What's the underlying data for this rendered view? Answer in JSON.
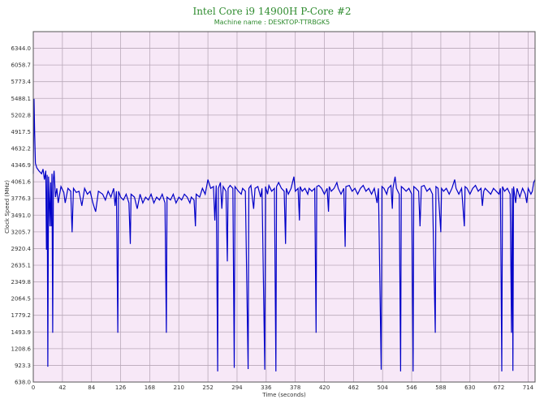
{
  "chart_data": {
    "type": "line",
    "title": "Intel Core i9 14900H P-Core #2",
    "subtitle": "Machine name : DESKTOP-TTRBGK5",
    "xlabel": "Time (seconds)",
    "ylabel": "Clock Speed (MHz)",
    "xlim": [
      0,
      724
    ],
    "ylim": [
      638.0,
      6629.0
    ],
    "x_ticks": [
      0,
      42,
      84,
      126,
      168,
      210,
      252,
      294,
      336,
      378,
      420,
      462,
      504,
      546,
      588,
      630,
      672,
      714
    ],
    "y_ticks": [
      638.0,
      923.3,
      1208.6,
      1493.9,
      1779.2,
      2064.5,
      2349.8,
      2635.1,
      2920.4,
      3205.7,
      3491.0,
      3776.3,
      4061.6,
      4346.9,
      4632.2,
      4917.5,
      5202.8,
      5488.1,
      5773.4,
      6058.7,
      6344.0
    ],
    "grid": true,
    "colors": {
      "line": "#0000c8",
      "plot_bg": "#f7e8f7",
      "grid": "#b9a9b9",
      "title": "#2e8b2e"
    },
    "series": [
      {
        "points": [
          [
            0,
            4200
          ],
          [
            1,
            5480
          ],
          [
            2,
            4900
          ],
          [
            3,
            4380
          ],
          [
            5,
            4300
          ],
          [
            8,
            4250
          ],
          [
            12,
            4200
          ],
          [
            14,
            4280
          ],
          [
            16,
            4100
          ],
          [
            18,
            4250
          ],
          [
            19,
            2900
          ],
          [
            20,
            4180
          ],
          [
            21,
            900
          ],
          [
            22,
            4150
          ],
          [
            24,
            3300
          ],
          [
            25,
            4050
          ],
          [
            26,
            3300
          ],
          [
            27,
            4200
          ],
          [
            28,
            1480
          ],
          [
            29,
            4120
          ],
          [
            30,
            4250
          ],
          [
            32,
            3800
          ],
          [
            34,
            3950
          ],
          [
            36,
            3700
          ],
          [
            40,
            3980
          ],
          [
            44,
            3880
          ],
          [
            46,
            3700
          ],
          [
            50,
            3950
          ],
          [
            54,
            3900
          ],
          [
            56,
            3200
          ],
          [
            58,
            3950
          ],
          [
            62,
            3880
          ],
          [
            66,
            3900
          ],
          [
            70,
            3650
          ],
          [
            74,
            3950
          ],
          [
            78,
            3850
          ],
          [
            82,
            3900
          ],
          [
            86,
            3700
          ],
          [
            90,
            3550
          ],
          [
            94,
            3900
          ],
          [
            100,
            3850
          ],
          [
            104,
            3750
          ],
          [
            108,
            3900
          ],
          [
            112,
            3800
          ],
          [
            116,
            3950
          ],
          [
            118,
            3650
          ],
          [
            120,
            3900
          ],
          [
            122,
            1480
          ],
          [
            123,
            3900
          ],
          [
            126,
            3800
          ],
          [
            130,
            3750
          ],
          [
            134,
            3850
          ],
          [
            138,
            3700
          ],
          [
            140,
            3000
          ],
          [
            141,
            3850
          ],
          [
            146,
            3800
          ],
          [
            150,
            3600
          ],
          [
            154,
            3850
          ],
          [
            158,
            3700
          ],
          [
            162,
            3800
          ],
          [
            166,
            3750
          ],
          [
            170,
            3850
          ],
          [
            174,
            3700
          ],
          [
            178,
            3800
          ],
          [
            182,
            3750
          ],
          [
            186,
            3850
          ],
          [
            190,
            3700
          ],
          [
            192,
            1480
          ],
          [
            193,
            3800
          ],
          [
            198,
            3750
          ],
          [
            202,
            3850
          ],
          [
            206,
            3700
          ],
          [
            210,
            3800
          ],
          [
            214,
            3750
          ],
          [
            218,
            3850
          ],
          [
            222,
            3800
          ],
          [
            226,
            3700
          ],
          [
            228,
            3800
          ],
          [
            232,
            3750
          ],
          [
            234,
            3300
          ],
          [
            235,
            3850
          ],
          [
            240,
            3800
          ],
          [
            244,
            3950
          ],
          [
            248,
            3850
          ],
          [
            252,
            4100
          ],
          [
            256,
            3950
          ],
          [
            260,
            3980
          ],
          [
            262,
            3400
          ],
          [
            264,
            4000
          ],
          [
            266,
            820
          ],
          [
            267,
            3950
          ],
          [
            270,
            4050
          ],
          [
            272,
            3600
          ],
          [
            274,
            3980
          ],
          [
            278,
            3900
          ],
          [
            280,
            2700
          ],
          [
            281,
            3950
          ],
          [
            284,
            4000
          ],
          [
            288,
            3950
          ],
          [
            290,
            880
          ],
          [
            291,
            3980
          ],
          [
            296,
            3900
          ],
          [
            300,
            3850
          ],
          [
            302,
            3950
          ],
          [
            306,
            3900
          ],
          [
            310,
            860
          ],
          [
            311,
            3950
          ],
          [
            314,
            4000
          ],
          [
            318,
            3600
          ],
          [
            320,
            3950
          ],
          [
            324,
            3980
          ],
          [
            328,
            3800
          ],
          [
            330,
            3950
          ],
          [
            334,
            850
          ],
          [
            335,
            3980
          ],
          [
            338,
            3850
          ],
          [
            340,
            4000
          ],
          [
            344,
            3900
          ],
          [
            348,
            3950
          ],
          [
            350,
            820
          ],
          [
            351,
            3980
          ],
          [
            354,
            4050
          ],
          [
            358,
            3950
          ],
          [
            362,
            3900
          ],
          [
            364,
            3000
          ],
          [
            365,
            3950
          ],
          [
            368,
            3850
          ],
          [
            372,
            3950
          ],
          [
            376,
            4150
          ],
          [
            378,
            3900
          ],
          [
            382,
            3950
          ],
          [
            384,
            3400
          ],
          [
            385,
            3980
          ],
          [
            388,
            3900
          ],
          [
            392,
            3950
          ],
          [
            396,
            3850
          ],
          [
            398,
            3950
          ],
          [
            402,
            3900
          ],
          [
            406,
            3950
          ],
          [
            408,
            1480
          ],
          [
            409,
            3980
          ],
          [
            412,
            4000
          ],
          [
            416,
            3950
          ],
          [
            420,
            3850
          ],
          [
            424,
            3950
          ],
          [
            426,
            3550
          ],
          [
            427,
            3980
          ],
          [
            430,
            3900
          ],
          [
            434,
            3950
          ],
          [
            438,
            4050
          ],
          [
            440,
            3950
          ],
          [
            444,
            3850
          ],
          [
            448,
            3950
          ],
          [
            450,
            2950
          ],
          [
            451,
            3980
          ],
          [
            456,
            4000
          ],
          [
            460,
            3900
          ],
          [
            464,
            3950
          ],
          [
            468,
            3850
          ],
          [
            472,
            3950
          ],
          [
            476,
            4000
          ],
          [
            480,
            3900
          ],
          [
            484,
            3950
          ],
          [
            488,
            3850
          ],
          [
            492,
            3950
          ],
          [
            496,
            3700
          ],
          [
            498,
            3950
          ],
          [
            502,
            850
          ],
          [
            503,
            3980
          ],
          [
            506,
            3950
          ],
          [
            510,
            3850
          ],
          [
            512,
            3950
          ],
          [
            516,
            4000
          ],
          [
            518,
            3600
          ],
          [
            519,
            3950
          ],
          [
            522,
            4150
          ],
          [
            524,
            3950
          ],
          [
            528,
            3850
          ],
          [
            530,
            820
          ],
          [
            531,
            3980
          ],
          [
            534,
            3950
          ],
          [
            538,
            3900
          ],
          [
            542,
            3950
          ],
          [
            546,
            3850
          ],
          [
            548,
            820
          ],
          [
            549,
            3980
          ],
          [
            552,
            3950
          ],
          [
            556,
            3900
          ],
          [
            558,
            3300
          ],
          [
            560,
            3980
          ],
          [
            564,
            4000
          ],
          [
            568,
            3900
          ],
          [
            572,
            3950
          ],
          [
            576,
            3850
          ],
          [
            580,
            1480
          ],
          [
            581,
            3980
          ],
          [
            584,
            3950
          ],
          [
            588,
            3200
          ],
          [
            589,
            3950
          ],
          [
            592,
            3900
          ],
          [
            596,
            3950
          ],
          [
            600,
            3850
          ],
          [
            604,
            3950
          ],
          [
            608,
            4100
          ],
          [
            610,
            3950
          ],
          [
            614,
            3850
          ],
          [
            618,
            3950
          ],
          [
            622,
            3300
          ],
          [
            623,
            3980
          ],
          [
            626,
            3950
          ],
          [
            630,
            3850
          ],
          [
            634,
            3950
          ],
          [
            638,
            4000
          ],
          [
            642,
            3900
          ],
          [
            646,
            3950
          ],
          [
            648,
            3650
          ],
          [
            650,
            3900
          ],
          [
            652,
            3950
          ],
          [
            656,
            3900
          ],
          [
            660,
            3850
          ],
          [
            664,
            3950
          ],
          [
            668,
            3900
          ],
          [
            672,
            3850
          ],
          [
            674,
            3950
          ],
          [
            676,
            820
          ],
          [
            677,
            3980
          ],
          [
            680,
            3900
          ],
          [
            684,
            3950
          ],
          [
            688,
            3850
          ],
          [
            690,
            1480
          ],
          [
            691,
            3950
          ],
          [
            692,
            830
          ],
          [
            693,
            3980
          ],
          [
            696,
            3700
          ],
          [
            698,
            3950
          ],
          [
            702,
            3800
          ],
          [
            706,
            3950
          ],
          [
            710,
            3850
          ],
          [
            712,
            3700
          ],
          [
            714,
            3950
          ],
          [
            718,
            3850
          ],
          [
            720,
            3900
          ],
          [
            722,
            4050
          ],
          [
            724,
            4100
          ]
        ]
      }
    ]
  }
}
